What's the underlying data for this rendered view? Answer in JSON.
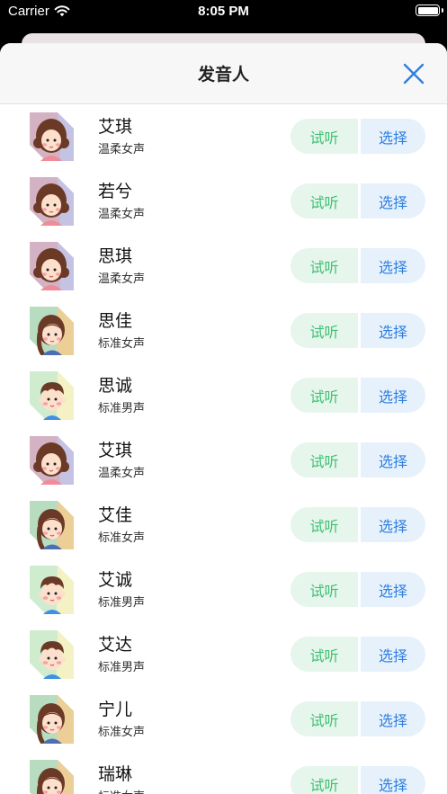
{
  "status_bar": {
    "carrier": "Carrier",
    "time": "8:05 PM",
    "battery_level_percent": 100
  },
  "sheet": {
    "title": "发音人",
    "close_icon": "close-icon"
  },
  "buttons": {
    "listen_label": "试听",
    "select_label": "选择"
  },
  "colors": {
    "listen_bg": "#e6f6ec",
    "listen_text": "#3ec071",
    "select_bg": "#e6f1fc",
    "select_text": "#2f7fe0",
    "close_icon": "#2f7fe0"
  },
  "voices": [
    {
      "name": "艾琪",
      "desc": "温柔女声",
      "avatar": "curly-hair-girl-avatar"
    },
    {
      "name": "若兮",
      "desc": "温柔女声",
      "avatar": "curly-hair-girl-avatar"
    },
    {
      "name": "思琪",
      "desc": "温柔女声",
      "avatar": "curly-hair-girl-avatar"
    },
    {
      "name": "思佳",
      "desc": "标准女声",
      "avatar": "braid-girl-avatar"
    },
    {
      "name": "思诚",
      "desc": "标准男声",
      "avatar": "boy-avatar"
    },
    {
      "name": "艾琪",
      "desc": "温柔女声",
      "avatar": "curly-hair-girl-avatar"
    },
    {
      "name": "艾佳",
      "desc": "标准女声",
      "avatar": "braid-girl-avatar"
    },
    {
      "name": "艾诚",
      "desc": "标准男声",
      "avatar": "boy-avatar"
    },
    {
      "name": "艾达",
      "desc": "标准男声",
      "avatar": "boy-avatar"
    },
    {
      "name": "宁儿",
      "desc": "标准女声",
      "avatar": "braid-girl-avatar"
    },
    {
      "name": "瑞琳",
      "desc": "标准女声",
      "avatar": "braid-girl-avatar"
    }
  ]
}
